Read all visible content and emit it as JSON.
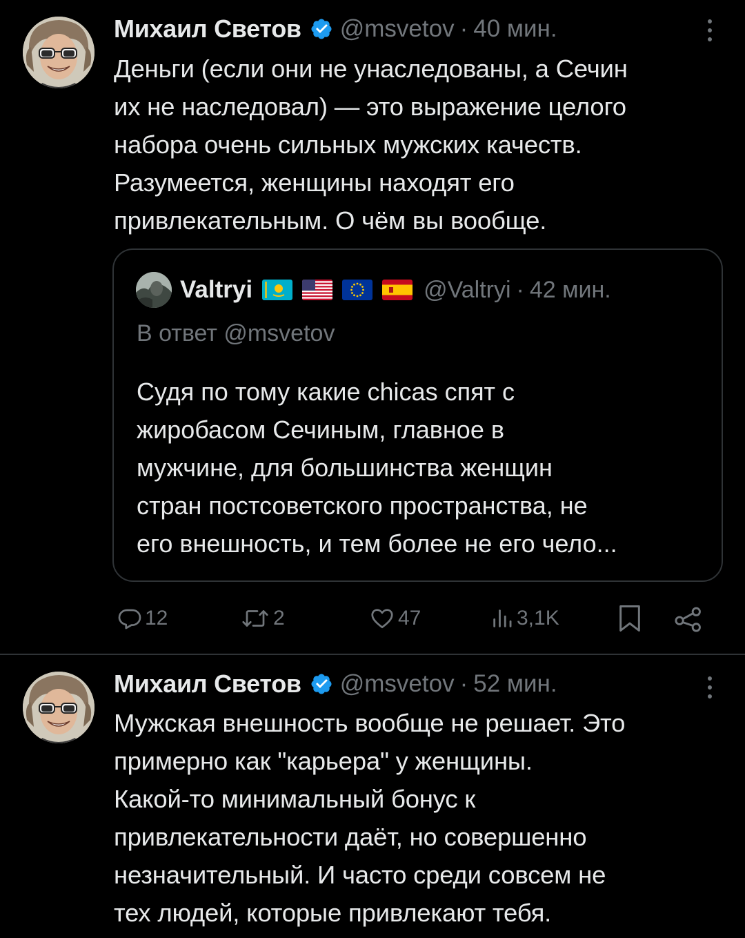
{
  "tweets": [
    {
      "author": "Михаил Светов",
      "handle": "@msvetov",
      "separator": "·",
      "time": "40 мин.",
      "text_lines": [
        "Деньги (если они не унаследованы, а Сечин",
        "их не наследовал) — это выражение целого",
        "набора очень сильных мужских качеств.",
        "Разумеется, женщины находят его",
        "привлекательным. О чём вы вообще."
      ],
      "quote": {
        "author": "Valtryi",
        "flags": [
          "kazakhstan-flag",
          "usa-flag",
          "eu-flag",
          "spain-flag"
        ],
        "handle": "@Valtryi",
        "separator": "·",
        "time": "42 мин.",
        "reply_to": "В ответ @msvetov",
        "text_lines": [
          "Судя по тому какие chicas спят с",
          "жиробасом Сечиным, главное в",
          "мужчине, для большинства женщин",
          "стран постсоветского пространства, не",
          "его внешность, и тем более не его чело..."
        ]
      },
      "actions": {
        "replies": "12",
        "retweets": "2",
        "likes": "47",
        "views": "3,1K"
      }
    },
    {
      "author": "Михаил Светов",
      "handle": "@msvetov",
      "separator": "·",
      "time": "52 мин.",
      "text_lines": [
        "Мужская внешность вообще не решает. Это",
        "примерно как \"карьера\" у женщины.",
        "Какой-то минимальный бонус к",
        "привлекательности даёт, но совершенно",
        "незначительный. И часто среди совсем не",
        "тех людей, которые привлекают тебя."
      ]
    }
  ],
  "colors": {
    "background": "#000000",
    "text": "#e7e9ea",
    "secondary": "#71767b",
    "border": "#2f3336",
    "verified": "#1d9bf0"
  }
}
